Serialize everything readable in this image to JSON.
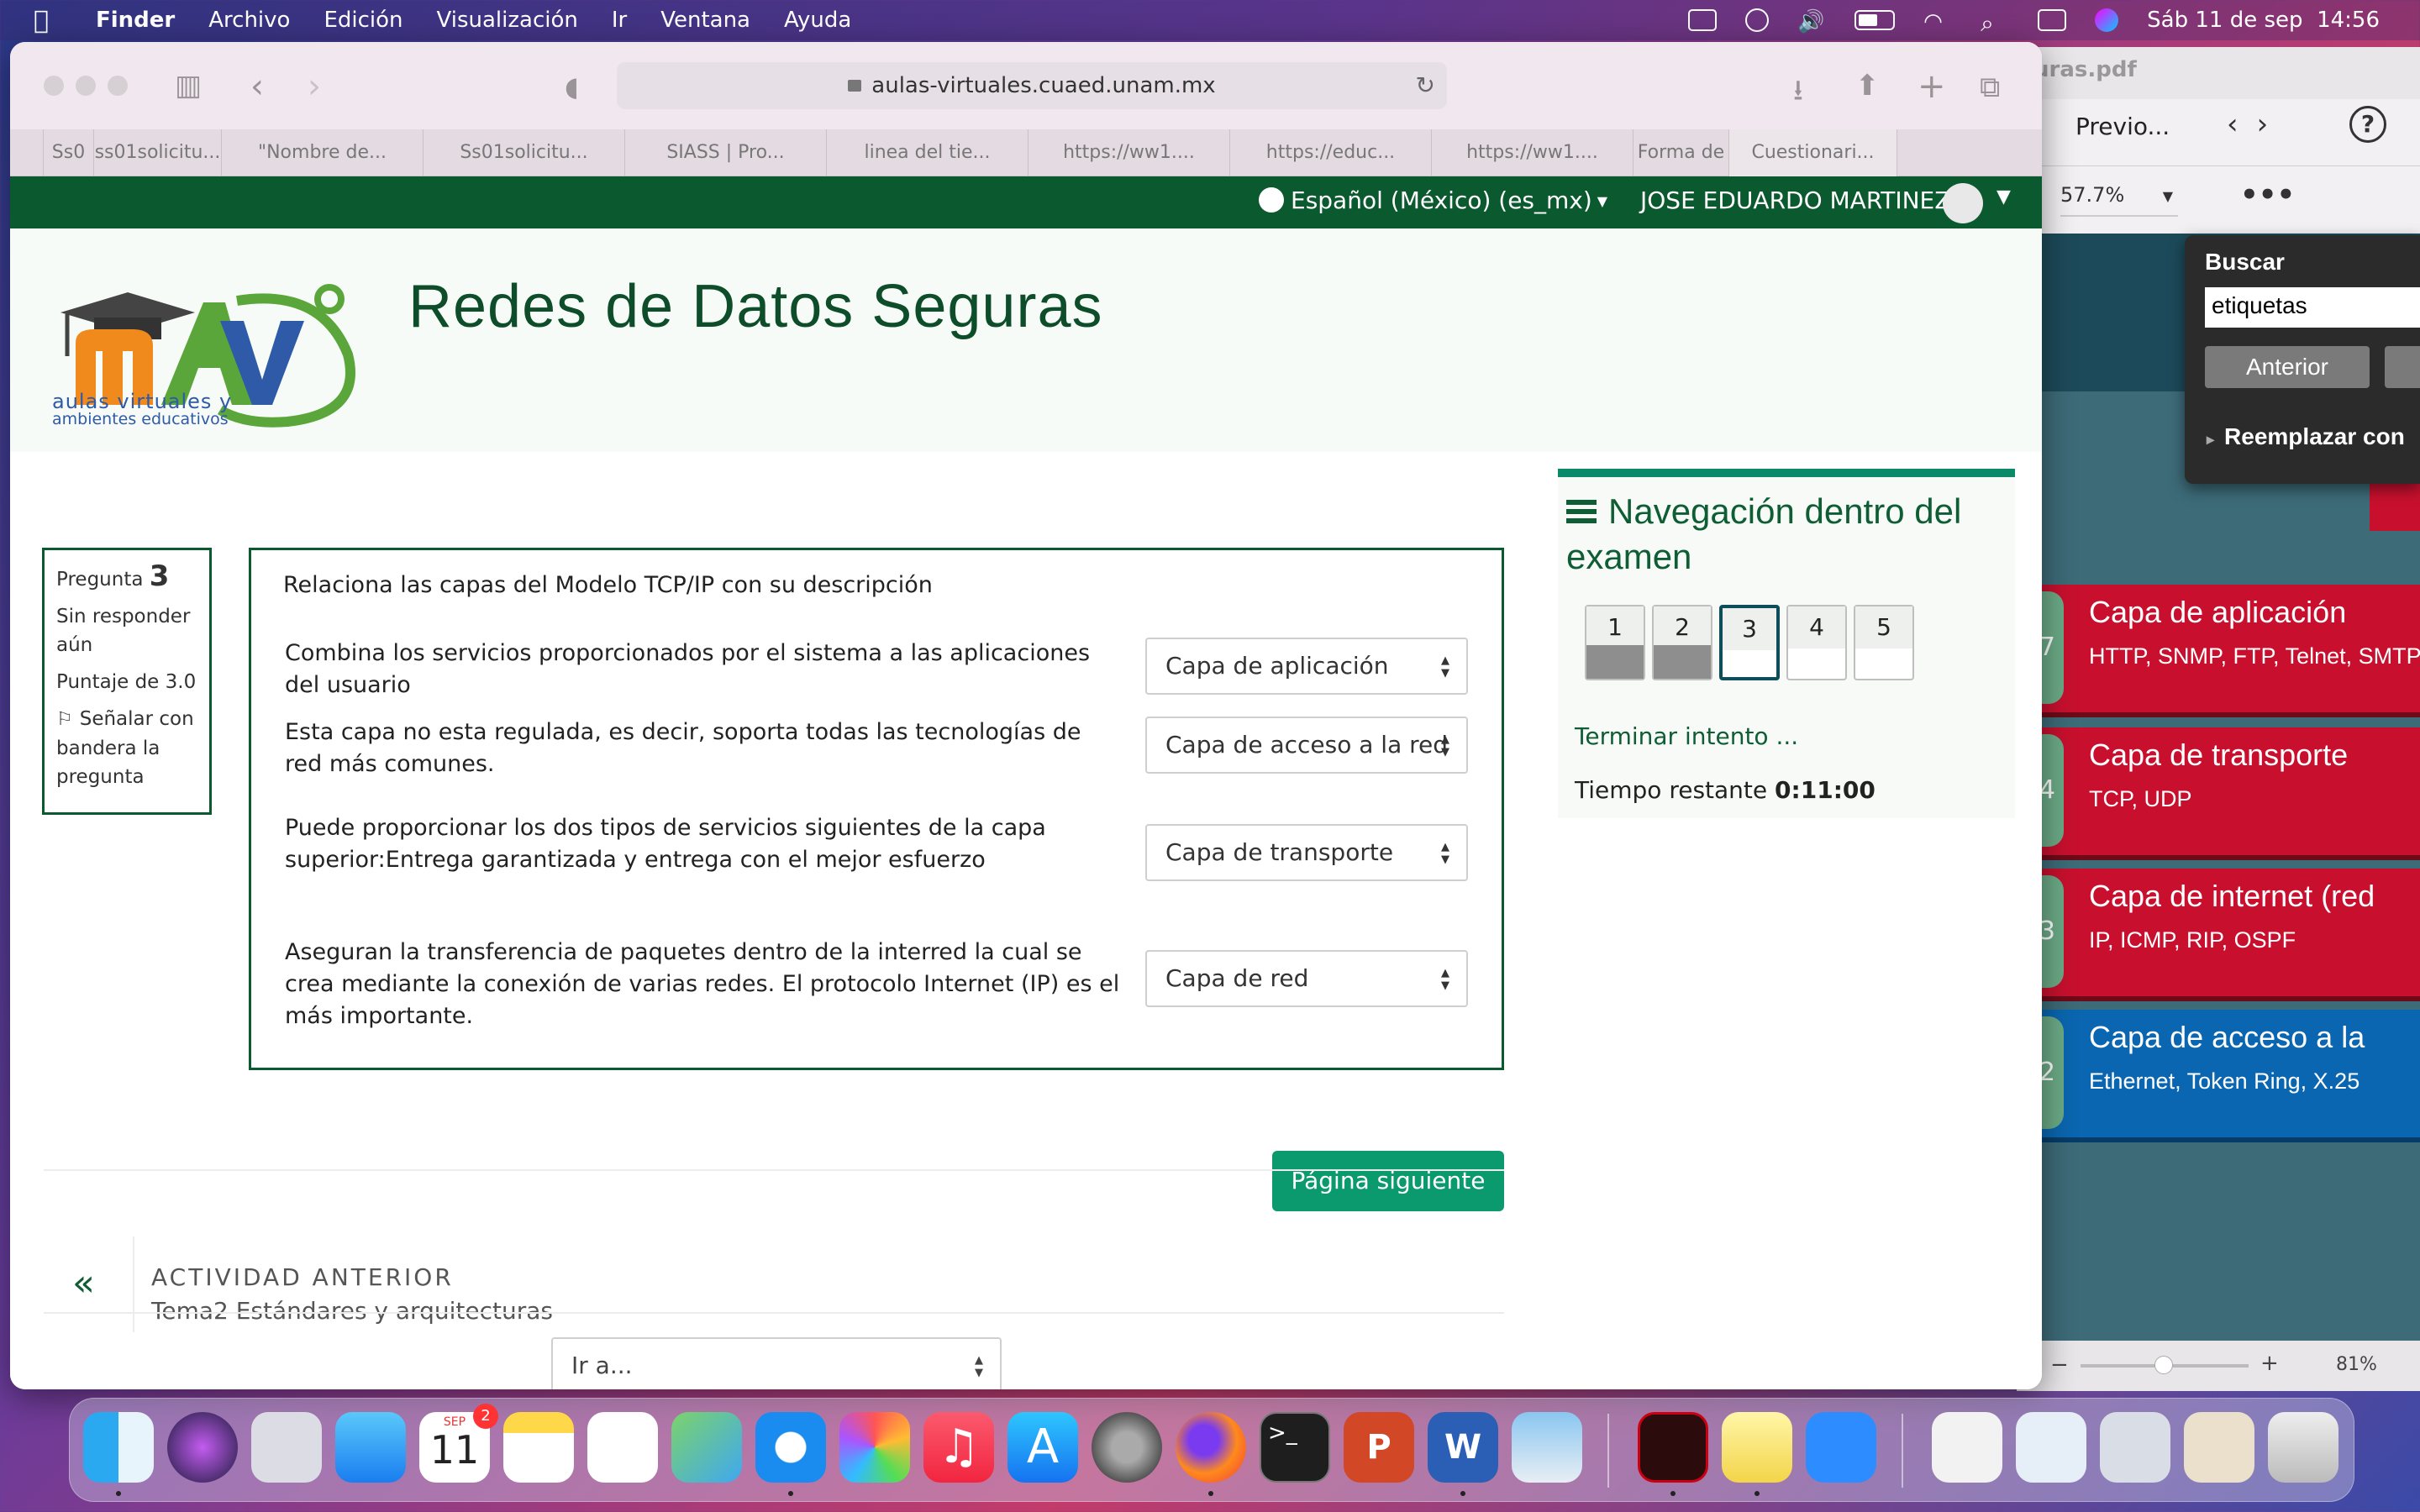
{
  "menubar": {
    "app": "Finder",
    "items": [
      "Archivo",
      "Edición",
      "Visualización",
      "Ir",
      "Ventana",
      "Ayuda"
    ],
    "clock": "Sáb 11 de sep  14:56"
  },
  "pdf_window": {
    "title": "uras.pdf",
    "preview_label": "Previo...",
    "zoom": "57.7%",
    "bottom_zoom": "81%",
    "find": {
      "title": "Buscar",
      "query": "etiquetas",
      "prev_button": "Anterior",
      "replace_label": "Reemplazar con"
    },
    "layers": [
      {
        "badge": "y 7",
        "title": "Capa de aplicación",
        "sub": "HTTP, SNMP, FTP, Telnet, SMTP"
      },
      {
        "badge": "4",
        "title": "Capa de transporte",
        "sub": "TCP, UDP"
      },
      {
        "badge": "3",
        "title": "Capa de internet (red",
        "sub": "IP, ICMP, RIP, OSPF"
      },
      {
        "badge": "y 2",
        "title": "Capa de acceso a la",
        "sub": "Ethernet, Token Ring, X.25"
      }
    ]
  },
  "browser": {
    "url": "aulas-virtuales.cuaed.unam.mx",
    "tabs": [
      "Ss0",
      "ss01solicitu...",
      "\"Nombre de...",
      "Ss01solicitu...",
      "SIASS | Pro...",
      "linea del tie...",
      "https://ww1....",
      "https://educ...",
      "https://ww1....",
      "Forma de",
      "Cuestionari..."
    ]
  },
  "moodle": {
    "language": "Español (México) (es_mx)",
    "user": "JOSE EDUARDO MARTINEZ",
    "logo_text_1": "aulas virtuales y",
    "logo_text_2": "ambientes educativos",
    "course_title": "Redes de Datos Seguras",
    "question_info": {
      "label": "Pregunta",
      "number": "3",
      "status": "Sin responder aún",
      "score": "Puntaje de 3.0",
      "flag": "Señalar con bandera la pregunta"
    },
    "question_text": "Relaciona las capas del Modelo TCP/IP con su descripción",
    "rows": [
      {
        "desc": "Combina los servicios proporcionados por el sistema a las aplicaciones del usuario",
        "selected": "Capa de aplicación"
      },
      {
        "desc": "Esta capa no esta regulada, es decir, soporta todas las tecnologías de red más comunes.",
        "selected": "Capa de acceso a la red"
      },
      {
        "desc": "Puede proporcionar los dos tipos de servicios siguientes de la capa superior:Entrega garantizada y entrega con el mejor esfuerzo",
        "selected": "Capa de transporte"
      },
      {
        "desc": "Aseguran la transferencia de paquetes dentro de la interred la cual se crea mediante la conexión de varias redes. El protocolo Internet (IP) es el más importante.",
        "selected": "Capa de red"
      }
    ],
    "next_button": "Página siguiente",
    "nav": {
      "title": "Navegación dentro del examen",
      "questions": [
        "1",
        "2",
        "3",
        "4",
        "5"
      ],
      "finish_link": "Terminar intento ...",
      "timer_label": "Tiempo restante",
      "timer_value": "0:11:00"
    },
    "prev_activity": {
      "label": "ACTIVIDAD ANTERIOR",
      "title": "Tema2 Estándares y arquitecturas"
    },
    "jump_select": "Ir a..."
  },
  "dock": {
    "calendar_month": "SEP",
    "calendar_day": "11",
    "calendar_badge": "2"
  }
}
